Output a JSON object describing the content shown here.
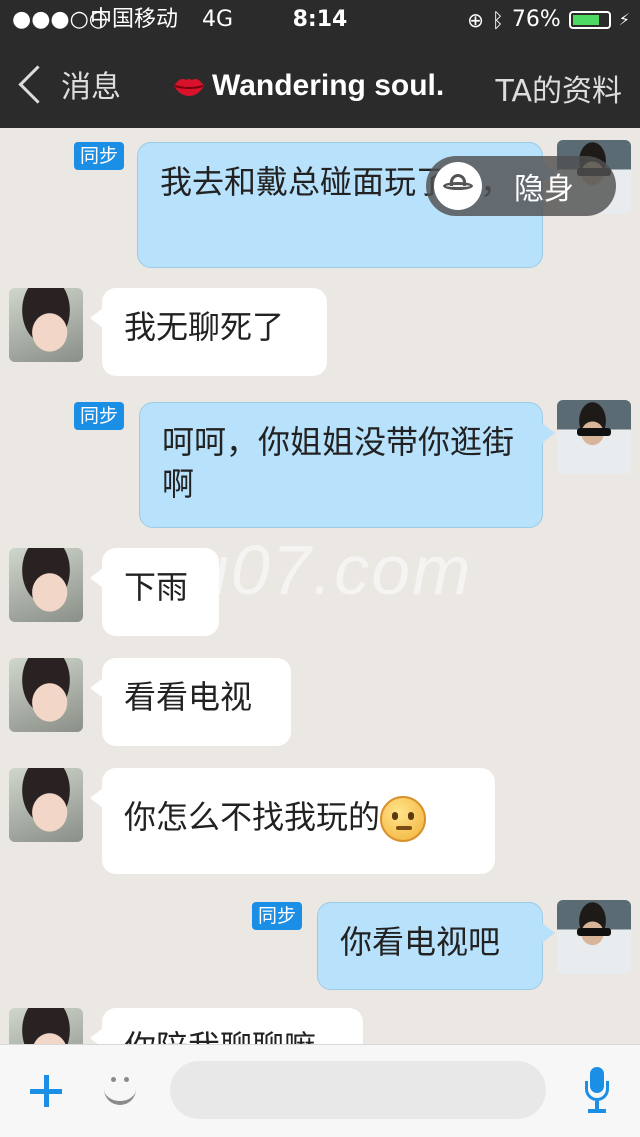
{
  "status_bar": {
    "signal": "●●●○○",
    "carrier": "中国移动",
    "network": "4G",
    "time": "8:14",
    "battery": "76%",
    "battery_level": 0.76
  },
  "nav": {
    "back_label": "消息",
    "title": "Wandering soul.",
    "profile_label": "TA的资料"
  },
  "stealth_label": "隐身",
  "sync_label": "同步",
  "messages": [
    {
      "side": "right",
      "text": "我去和戴总碰面玩了了，",
      "sync": true
    },
    {
      "side": "left",
      "text": "我无聊死了"
    },
    {
      "side": "right",
      "text": "呵呵，你姐姐没带你逛街啊",
      "sync": true
    },
    {
      "side": "left",
      "text": "下雨"
    },
    {
      "side": "left",
      "text": "看看电视"
    },
    {
      "side": "left",
      "text": "你怎么不找我玩的",
      "emoji": "thinking-emoji"
    },
    {
      "side": "right",
      "text": "你看电视吧",
      "sync": true
    },
    {
      "side": "left",
      "text": "你陪我聊聊嘛"
    }
  ],
  "watermark": "u07.com",
  "input": {
    "placeholder": ""
  },
  "colors": {
    "nav_bg": "#2b2b2b",
    "chat_bg": "#ebe7e2",
    "my_bubble": "#b8e1fb",
    "sync_badge": "#1b8ee6"
  }
}
